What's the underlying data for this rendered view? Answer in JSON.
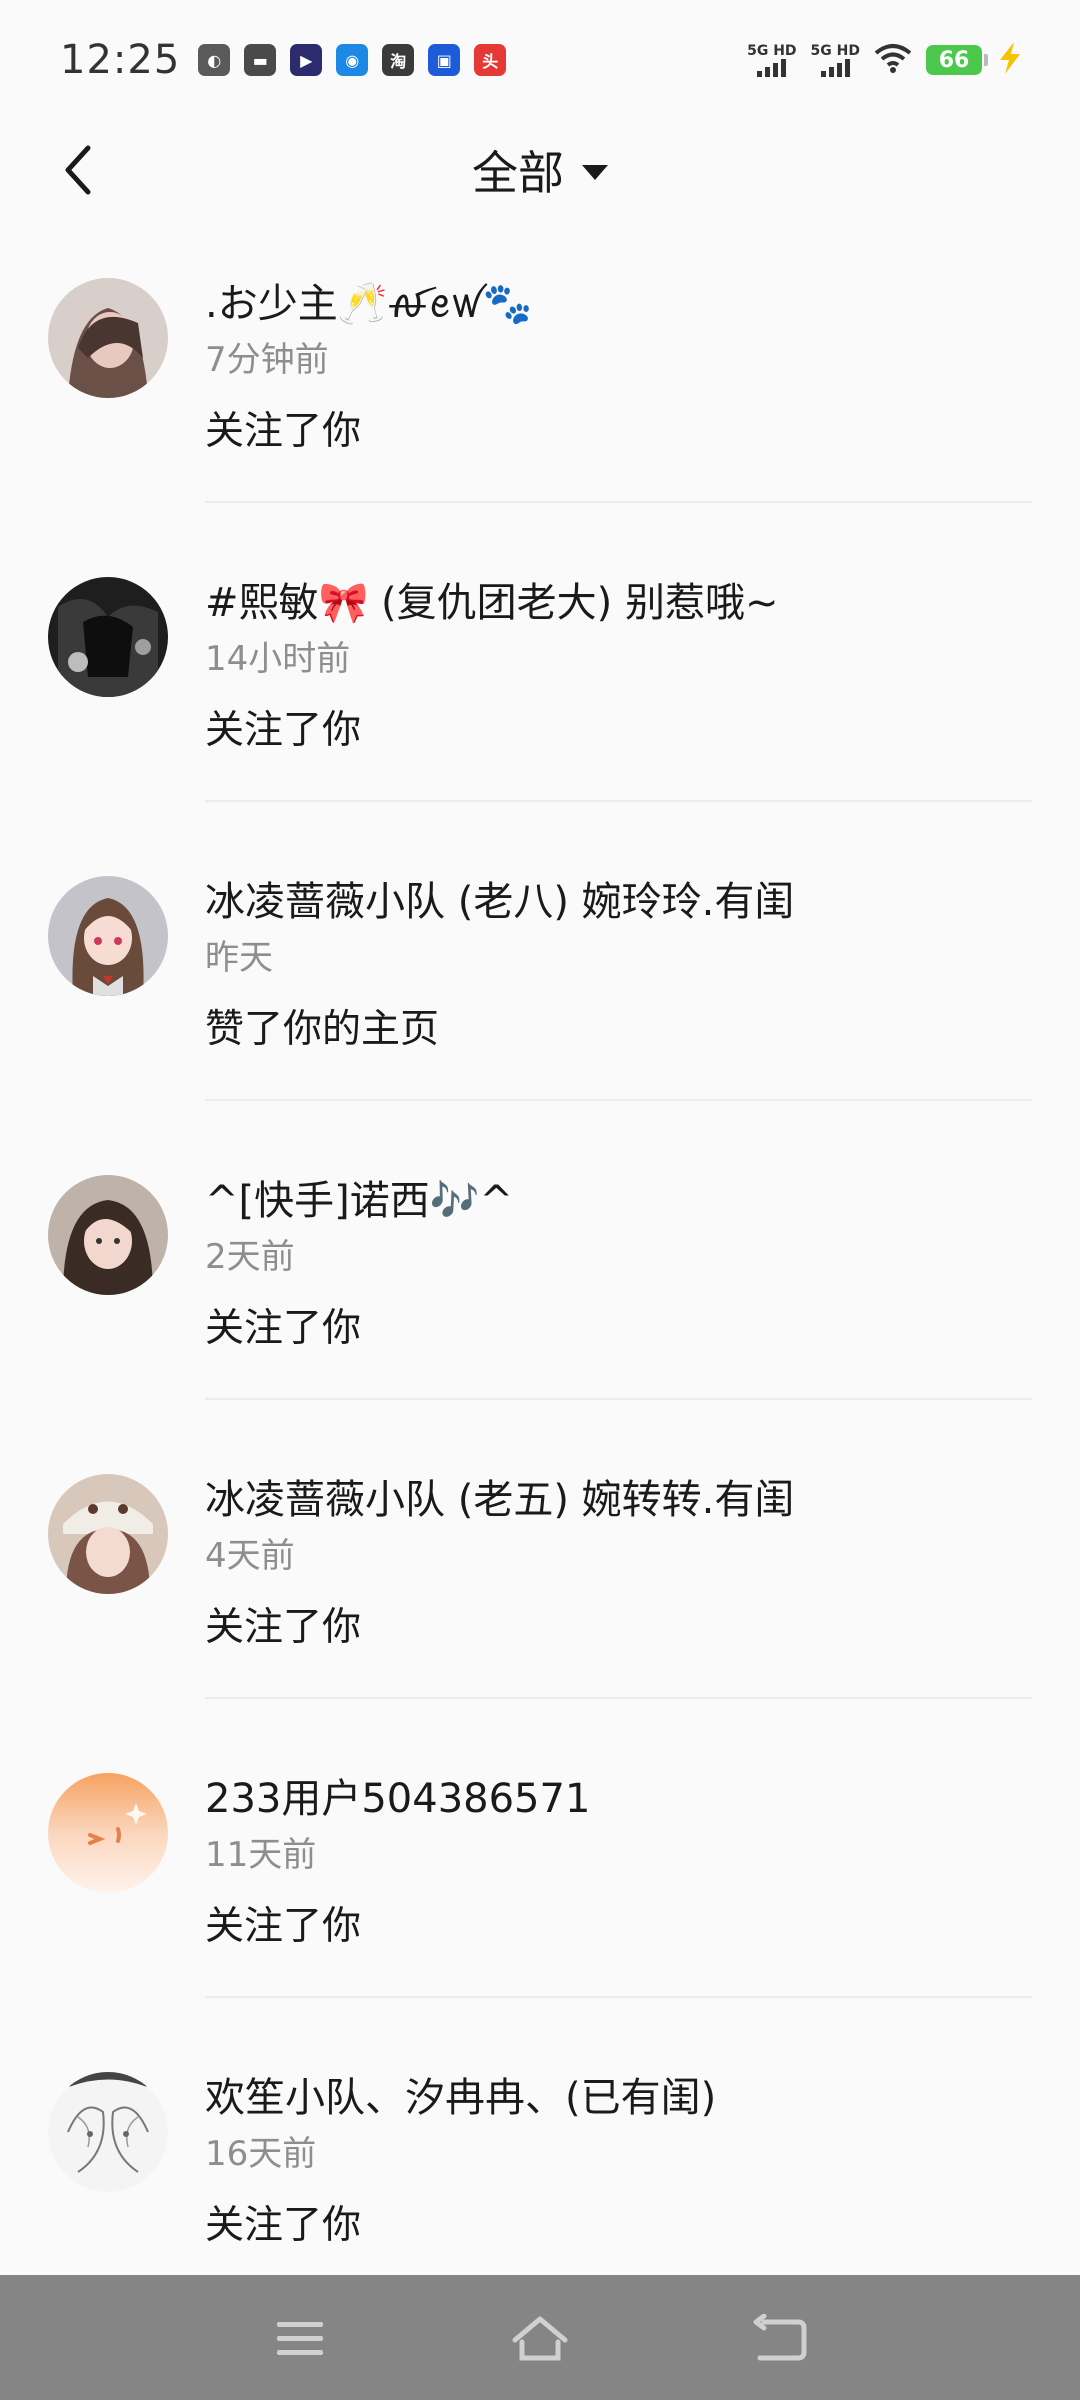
{
  "status_bar": {
    "time": "12:25",
    "notification_icons": [
      {
        "name": "app-icon-1",
        "color": "#5a5a5a",
        "glyph": "◐"
      },
      {
        "name": "app-icon-2",
        "color": "#4a4a4a",
        "glyph": "▬"
      },
      {
        "name": "app-icon-3",
        "color": "#2b2b6e",
        "glyph": "▶"
      },
      {
        "name": "app-icon-4",
        "color": "#1e88e5",
        "glyph": "◉"
      },
      {
        "name": "taobao-icon",
        "color": "#3a3a3a",
        "glyph": "淘"
      },
      {
        "name": "app-icon-6",
        "color": "#1e5bd8",
        "glyph": "▣"
      },
      {
        "name": "toutiao-icon",
        "color": "#e53935",
        "glyph": "头"
      }
    ],
    "signal_1_label": "5G HD",
    "signal_2_label": "5G HD",
    "battery": "66",
    "accent": "#4cc94c"
  },
  "header": {
    "filter_label": "全部"
  },
  "items": [
    {
      "name": ".お少主🥂ꫛꫀꪝ🐾",
      "time": "7分钟前",
      "action": "关注了你",
      "avatar_color": "#9a7a72"
    },
    {
      "name": "#熙敏🎀 (复仇团老大) 别惹哦~",
      "time": "14小时前",
      "action": "关注了你",
      "avatar_color": "#2a2a2a"
    },
    {
      "name": "冰凌蔷薇小队 (老八) 婉玲玲.有闺",
      "time": "昨天",
      "action": "赞了你的主页",
      "avatar_color": "#b8b8c0"
    },
    {
      "name": "^[快手]诺西🎶^",
      "time": "2天前",
      "action": "关注了你",
      "avatar_color": "#6e5e58"
    },
    {
      "name": "冰凌蔷薇小队 (老五) 婉转转.有闺",
      "time": "4天前",
      "action": "关注了你",
      "avatar_color": "#c9b4a4"
    },
    {
      "name": "233用户504386571",
      "time": "11天前",
      "action": "关注了你",
      "avatar_color": "#f5a66b"
    },
    {
      "name": "欢笙小队、汐冉冉、(已有闺)",
      "time": "16天前",
      "action": "关注了你",
      "avatar_color": "#e8e8e8"
    }
  ]
}
